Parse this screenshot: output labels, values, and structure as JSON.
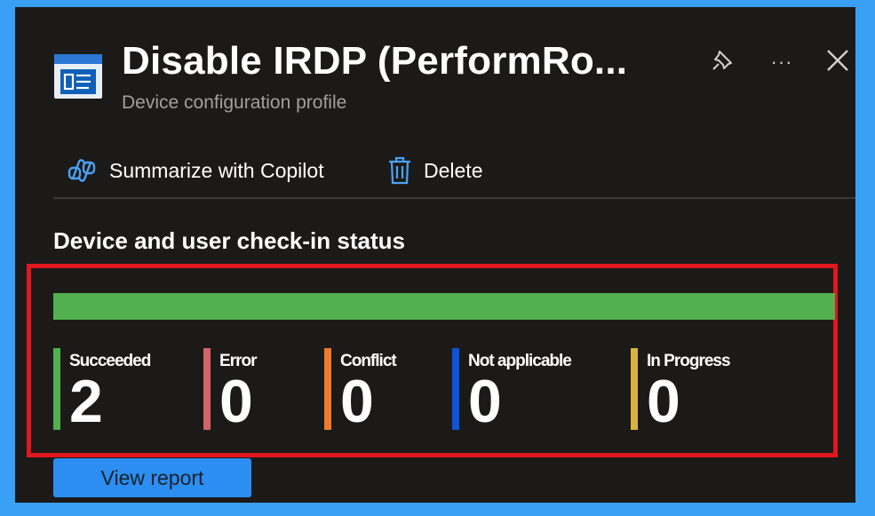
{
  "header": {
    "title": "Disable IRDP (PerformRo...",
    "subtitle": "Device configuration profile",
    "more_label": "···"
  },
  "toolbar": {
    "copilot_label": "Summarize with Copilot",
    "delete_label": "Delete"
  },
  "section": {
    "title": "Device and user check-in status"
  },
  "status_bar": {
    "succeeded_fraction": 1.0,
    "fill_color": "#52b04f"
  },
  "metrics": [
    {
      "label": "Succeeded",
      "value": "2",
      "color": "#52b04f"
    },
    {
      "label": "Error",
      "value": "0",
      "color": "#d4636b"
    },
    {
      "label": "Conflict",
      "value": "0",
      "color": "#f07a2a"
    },
    {
      "label": "Not applicable",
      "value": "0",
      "color": "#0e54d8"
    },
    {
      "label": "In Progress",
      "value": "0",
      "color": "#d8b43e"
    }
  ],
  "actions": {
    "view_report_label": "View report"
  },
  "colors": {
    "page_background": "#3aa0f6",
    "panel_background": "#1b1a19",
    "highlight_border": "#e2171e",
    "accent": "#2b8ef0"
  },
  "icons": {
    "profile": "profile-config-icon",
    "pin": "pin-icon",
    "more": "more-icon",
    "close": "close-icon",
    "copilot": "copilot-icon",
    "delete": "trash-icon"
  }
}
